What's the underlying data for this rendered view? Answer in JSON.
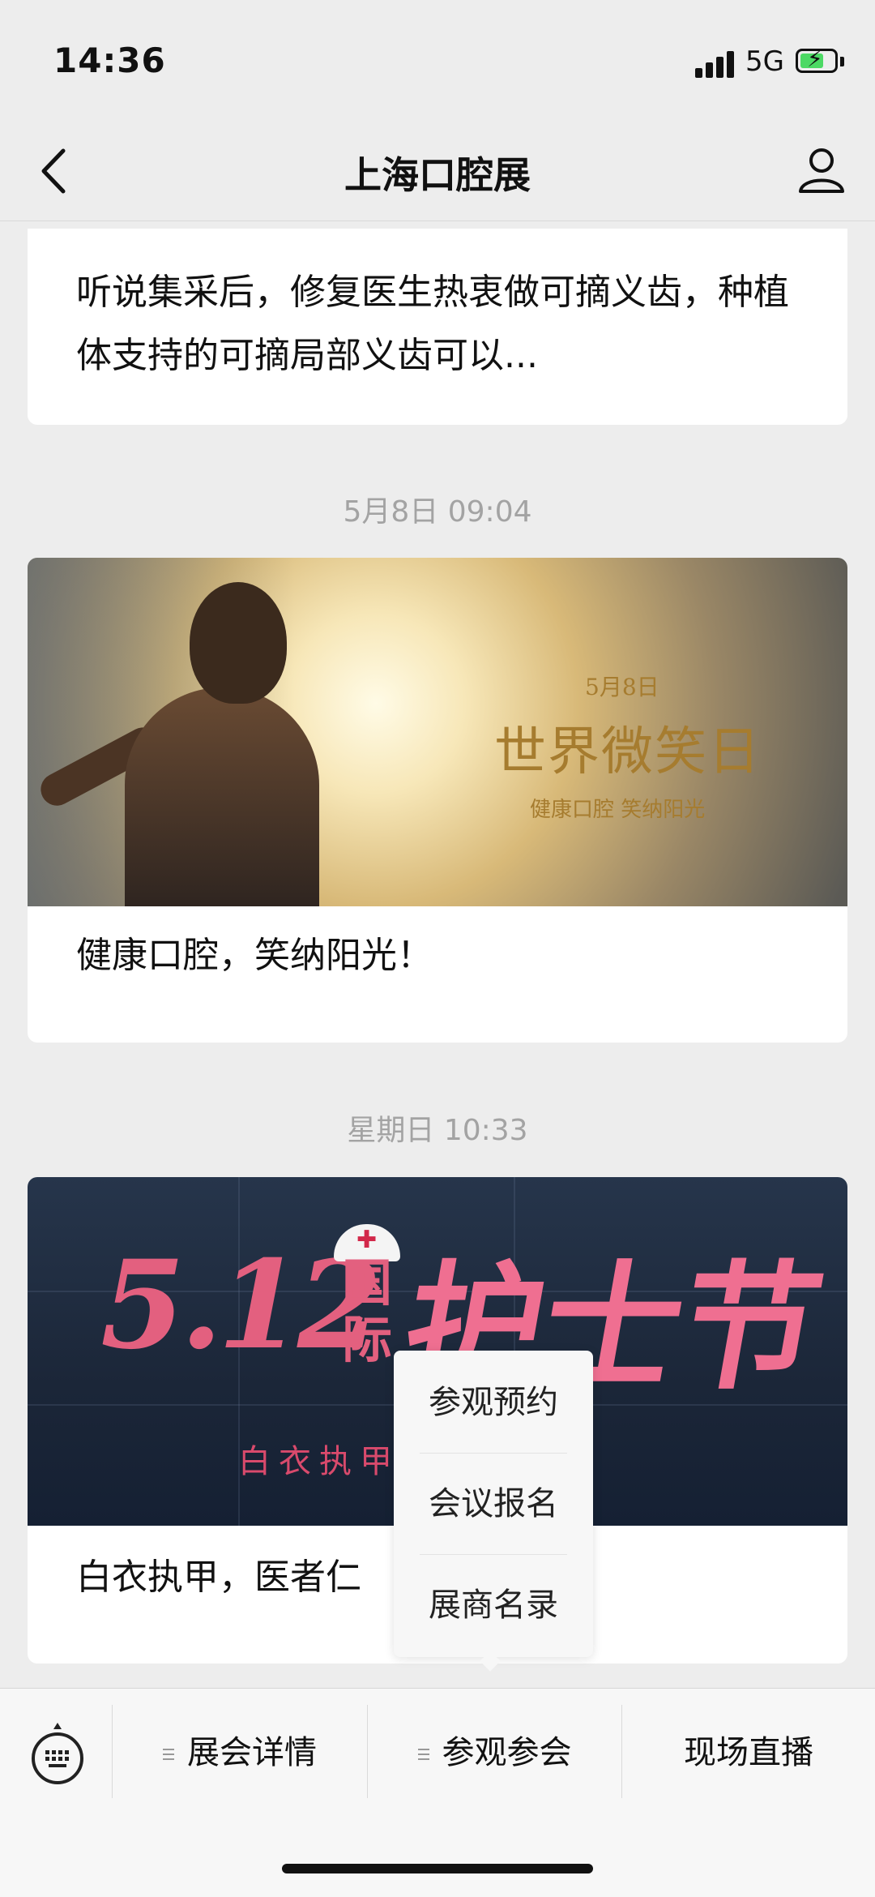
{
  "status_bar": {
    "time": "14:36",
    "network": "5G"
  },
  "nav": {
    "title": "上海口腔展"
  },
  "feed": [
    {
      "text": "听说集采后，修复医生热衷做可摘义齿，种植体支持的可摘局部义齿可以..."
    },
    {
      "timestamp": "5月8日 09:04",
      "image": {
        "date": "5月8日",
        "headline": "世界微笑日",
        "tagline": "健康口腔 笑纳阳光"
      },
      "text": "健康口腔，笑纳阳光！"
    },
    {
      "timestamp": "星期日 10:33",
      "image": {
        "big": "5.12",
        "guoji": "国际",
        "jie": "护士节",
        "sub": "白衣执甲"
      },
      "text": "白衣执甲，医者仁"
    }
  ],
  "popup_menu": {
    "items": [
      "参观预约",
      "会议报名",
      "展商名录"
    ]
  },
  "bottom_menu": {
    "keyboard_icon": "keyboard-icon",
    "items": [
      {
        "label": "展会详情",
        "has_submenu": true
      },
      {
        "label": "参观参会",
        "has_submenu": true
      },
      {
        "label": "现场直播",
        "has_submenu": false
      }
    ]
  },
  "colors": {
    "accent_gold": "#a67c2f",
    "nurse_pink": "#e3607f",
    "battery_green": "#4cd964"
  }
}
